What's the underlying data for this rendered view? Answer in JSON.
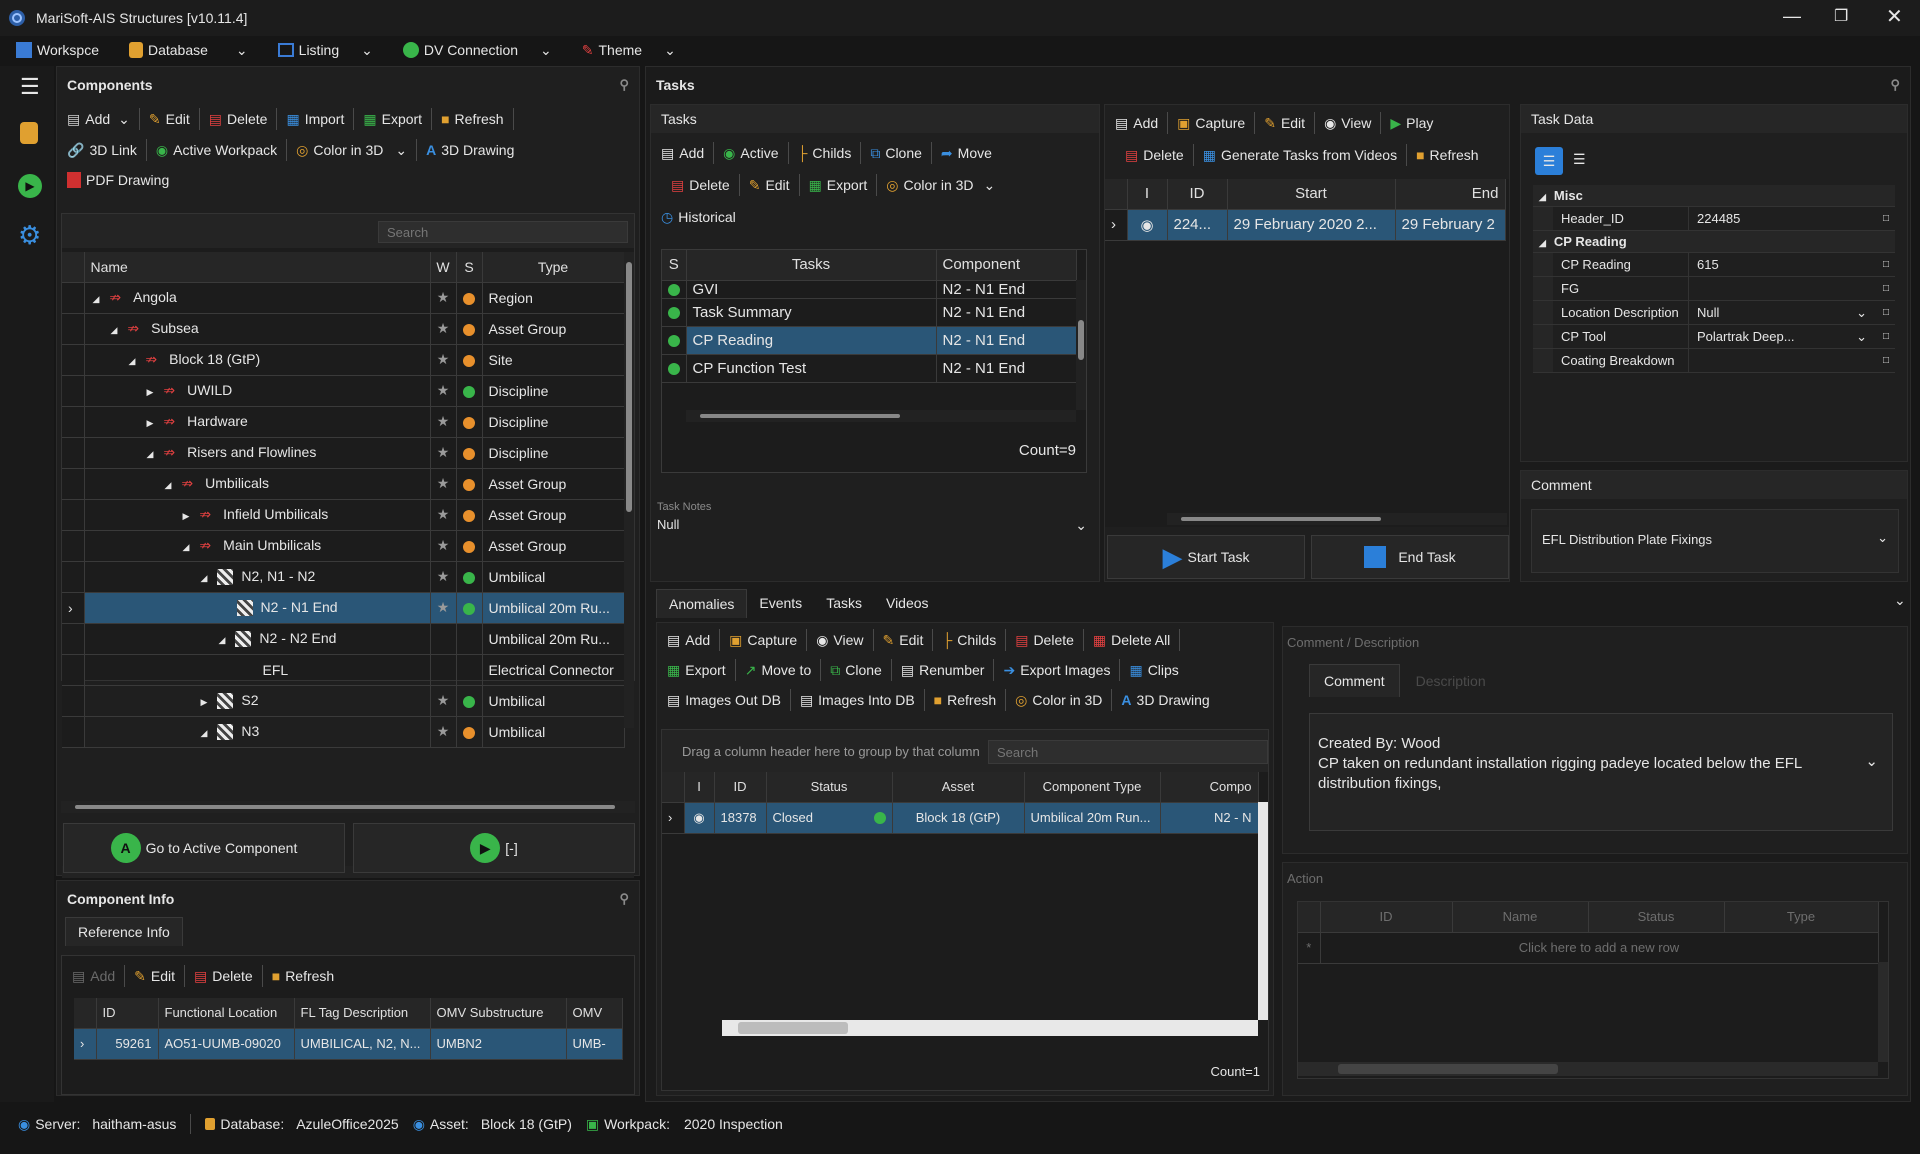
{
  "app": {
    "title": "MariSoft-AIS Structures [v10.11.4]"
  },
  "menu": [
    {
      "label": "Workspce"
    },
    {
      "label": "Database"
    },
    {
      "label": "Listing"
    },
    {
      "label": "DV Connection"
    },
    {
      "label": "Theme"
    }
  ],
  "components": {
    "title": "Components",
    "toolbar": {
      "add": "Add",
      "edit": "Edit",
      "delete": "Delete",
      "import": "Import",
      "export": "Export",
      "refresh": "Refresh",
      "link3d": "3D Link",
      "active_workpack": "Active Workpack",
      "color3d": "Color in 3D",
      "drawing3d": "3D Drawing",
      "pdf_drawing": "PDF Drawing"
    },
    "search_placeholder": "Search",
    "columns": [
      "Name",
      "W",
      "S",
      "Type"
    ],
    "rows": [
      {
        "name": "Angola",
        "type": "Region",
        "status": "orange"
      },
      {
        "name": "Subsea",
        "type": "Asset Group",
        "status": "orange"
      },
      {
        "name": "Block 18 (GtP)",
        "type": "Site",
        "status": "orange"
      },
      {
        "name": "UWILD",
        "type": "Discipline",
        "status": "green"
      },
      {
        "name": "Hardware",
        "type": "Discipline",
        "status": "orange"
      },
      {
        "name": "Risers and Flowlines",
        "type": "Discipline",
        "status": "orange"
      },
      {
        "name": "Umbilicals",
        "type": "Asset Group",
        "status": "orange"
      },
      {
        "name": "Infield Umbilicals",
        "type": "Asset Group",
        "status": "orange"
      },
      {
        "name": "Main Umbilicals",
        "type": "Asset Group",
        "status": "orange"
      },
      {
        "name": "N2, N1 - N2",
        "type": "Umbilical",
        "status": "green"
      },
      {
        "name": "N2 - N1 End",
        "type": "Umbilical 20m Ru...",
        "status": "green"
      },
      {
        "name": "N2 - N2 End",
        "type": "Umbilical 20m Ru...",
        "status": "none"
      },
      {
        "name": "EFL",
        "type": "Electrical Connector",
        "status": "none"
      },
      {
        "name": "S2",
        "type": "Umbilical",
        "status": "green"
      },
      {
        "name": "N3",
        "type": "Umbilical",
        "status": "orange"
      }
    ],
    "go_active": "Go to Active Component",
    "active_value": "[-]"
  },
  "component_info": {
    "title": "Component Info",
    "tab": "Reference Info",
    "toolbar": {
      "add": "Add",
      "edit": "Edit",
      "delete": "Delete",
      "refresh": "Refresh"
    },
    "columns": [
      "ID",
      "Functional Location",
      "FL Tag Description",
      "OMV Substructure",
      "OMV"
    ],
    "row": [
      "59261",
      "AO51-UUMB-09020",
      "UMBILICAL, N2, N...",
      "UMBN2",
      "UMB-"
    ]
  },
  "tasks": {
    "title": "Tasks",
    "sub": "Tasks",
    "toolbar": {
      "add": "Add",
      "active": "Active",
      "childs": "Childs",
      "clone": "Clone",
      "move": "Move",
      "delete": "Delete",
      "edit": "Edit",
      "export": "Export",
      "color3d": "Color in 3D",
      "historical": "Historical"
    },
    "columns": [
      "S",
      "Tasks",
      "Component"
    ],
    "rows": [
      {
        "task": "GVI",
        "comp": "N2 - N1 End"
      },
      {
        "task": "Task Summary",
        "comp": "N2 - N1 End"
      },
      {
        "task": "CP Reading",
        "comp": "N2 - N1 End"
      },
      {
        "task": "CP Function Test",
        "comp": "N2 - N1 End"
      }
    ],
    "count": "Count=9",
    "notes_label": "Task Notes",
    "notes_value": "Null",
    "toolbar2": {
      "add": "Add",
      "capture": "Capture",
      "edit": "Edit",
      "view": "View",
      "play": "Play",
      "delete": "Delete",
      "generate": "Generate Tasks from Videos",
      "refresh": "Refresh"
    },
    "run_columns": [
      "I",
      "ID",
      "Start",
      "End"
    ],
    "run_row": [
      "224...",
      "29 February 2020 2...",
      "29 February 2"
    ],
    "start_task": "Start Task",
    "end_task": "End Task"
  },
  "task_data": {
    "title": "Task Data",
    "groups": [
      {
        "name": "Misc",
        "props": [
          {
            "k": "Header_ID",
            "v": "224485"
          }
        ]
      },
      {
        "name": "CP Reading",
        "props": [
          {
            "k": "CP Reading",
            "v": "615"
          },
          {
            "k": "FG",
            "v": ""
          },
          {
            "k": "Location Description",
            "v": "Null"
          },
          {
            "k": "CP Tool",
            "v": "Polartrak  Deep..."
          },
          {
            "k": "Coating Breakdown",
            "v": ""
          }
        ]
      }
    ],
    "comment_label": "Comment",
    "comment_value": "EFL Distribution Plate Fixings"
  },
  "bottom_tabs": [
    "Anomalies",
    "Events",
    "Tasks",
    "Videos"
  ],
  "anomalies": {
    "toolbar": {
      "add": "Add",
      "capture": "Capture",
      "view": "View",
      "edit": "Edit",
      "childs": "Childs",
      "delete": "Delete",
      "delete_all": "Delete All",
      "export": "Export",
      "move_to": "Move to",
      "clone": "Clone",
      "renumber": "Renumber",
      "export_images": "Export Images",
      "clips": "Clips",
      "images_out": "Images Out DB",
      "images_into": "Images Into DB",
      "refresh": "Refresh",
      "color3d": "Color in 3D",
      "drawing3d": "3D Drawing"
    },
    "group_hint": "Drag a column header here to group by that column",
    "search_placeholder": "Search",
    "columns": [
      "I",
      "ID",
      "Status",
      "Asset",
      "Component Type",
      "Compo"
    ],
    "row": [
      "18378",
      "Closed",
      "Block 18 (GtP)",
      "Umbilical 20m Run...",
      "N2 - N"
    ],
    "count": "Count=1"
  },
  "comment_desc": {
    "title": "Comment / Description",
    "tabs": [
      "Comment",
      "Description"
    ],
    "text_line1": "Created By: Wood",
    "text_line2": "CP taken on redundant installation rigging padeye located below the EFL distribution fixings,"
  },
  "action": {
    "title": "Action",
    "columns": [
      "ID",
      "Name",
      "Status",
      "Type"
    ],
    "new_row": "Click here to add a new row"
  },
  "status": {
    "server_label": "Server:",
    "server": "haitham-asus",
    "db_label": "Database:",
    "db": "AzuleOffice2025",
    "asset_label": "Asset:",
    "asset": "Block 18 (GtP)",
    "workpack_label": "Workpack:",
    "workpack": "2020 Inspection"
  }
}
